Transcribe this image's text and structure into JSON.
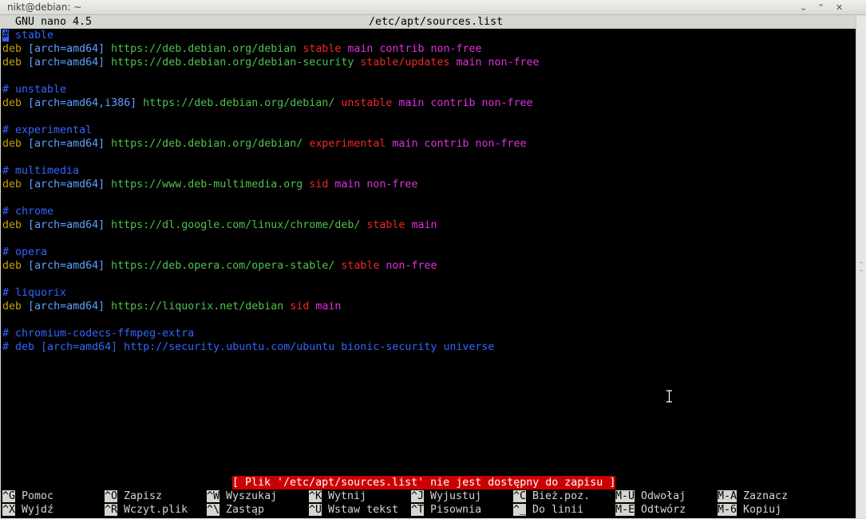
{
  "window": {
    "title": "nikt@debian: ~",
    "minimize": "⌃",
    "maximize": "⌃",
    "close": "✕"
  },
  "nano": {
    "version": "GNU nano 4.5",
    "filename": "/etc/apt/sources.list"
  },
  "file_lines": [
    {
      "type": "comment",
      "text": "# stable"
    },
    {
      "type": "deb",
      "deb": "deb",
      "arch": "[arch=amd64]",
      "url": "https://deb.debian.org/debian",
      "dist": "stable",
      "components": "main contrib non-free"
    },
    {
      "type": "deb",
      "deb": "deb",
      "arch": "[arch=amd64]",
      "url": "https://deb.debian.org/debian-security",
      "dist": "stable/updates",
      "components": "main non-free"
    },
    {
      "type": "blank"
    },
    {
      "type": "comment",
      "text": "# unstable"
    },
    {
      "type": "deb",
      "deb": "deb",
      "arch": "[arch=amd64,i386]",
      "url": "https://deb.debian.org/debian/",
      "dist": "unstable",
      "components": "main contrib non-free"
    },
    {
      "type": "blank"
    },
    {
      "type": "comment",
      "text": "# experimental"
    },
    {
      "type": "deb",
      "deb": "deb",
      "arch": "[arch=amd64]",
      "url": "https://deb.debian.org/debian/",
      "dist": "experimental",
      "components": "main contrib non-free"
    },
    {
      "type": "blank"
    },
    {
      "type": "comment",
      "text": "# multimedia"
    },
    {
      "type": "deb",
      "deb": "deb",
      "arch": "[arch=amd64]",
      "url": "https://www.deb-multimedia.org",
      "dist": "sid",
      "components": "main non-free"
    },
    {
      "type": "blank"
    },
    {
      "type": "comment",
      "text": "# chrome"
    },
    {
      "type": "deb",
      "deb": "deb",
      "arch": "[arch=amd64]",
      "url": "https://dl.google.com/linux/chrome/deb/",
      "dist": "stable",
      "components": "main"
    },
    {
      "type": "blank"
    },
    {
      "type": "comment",
      "text": "# opera"
    },
    {
      "type": "deb",
      "deb": "deb",
      "arch": "[arch=amd64]",
      "url": "https://deb.opera.com/opera-stable/",
      "dist": "stable",
      "components": "non-free"
    },
    {
      "type": "blank"
    },
    {
      "type": "comment",
      "text": "# liquorix"
    },
    {
      "type": "deb",
      "deb": "deb",
      "arch": "[arch=amd64]",
      "url": "https://liquorix.net/debian",
      "dist": "sid",
      "components": "main"
    },
    {
      "type": "blank"
    },
    {
      "type": "comment",
      "text": "# chromium-codecs-ffmpeg-extra"
    },
    {
      "type": "comment",
      "text": "# deb [arch=amd64] http://security.ubuntu.com/ubuntu bionic-security universe"
    }
  ],
  "status_message": "[ Plik '/etc/apt/sources.list' nie jest dostępny do zapisu ]",
  "shortcuts_row1": [
    {
      "key": "^G",
      "label": "Pomoc"
    },
    {
      "key": "^O",
      "label": "Zapisz"
    },
    {
      "key": "^W",
      "label": "Wyszukaj"
    },
    {
      "key": "^K",
      "label": "Wytnij"
    },
    {
      "key": "^J",
      "label": "Wyjustuj"
    },
    {
      "key": "^C",
      "label": "Bież.poz."
    },
    {
      "key": "M-U",
      "label": "Odwołaj"
    },
    {
      "key": "M-A",
      "label": "Zaznacz"
    }
  ],
  "shortcuts_row2": [
    {
      "key": "^X",
      "label": "Wyjdź"
    },
    {
      "key": "^R",
      "label": "Wczyt.plik"
    },
    {
      "key": "^\\",
      "label": "Zastąp"
    },
    {
      "key": "^U",
      "label": "Wstaw tekst"
    },
    {
      "key": "^T",
      "label": "Pisownia"
    },
    {
      "key": "^_",
      "label": "Do linii"
    },
    {
      "key": "M-E",
      "label": "Odtwórz"
    },
    {
      "key": "M-6",
      "label": "Kopiuj"
    }
  ],
  "colors": {
    "comment": "#3465ff",
    "deb": "#c4a000",
    "arch": "#5ea0ff",
    "url": "#4ec24e",
    "dist": "#ef2929",
    "components": "#e030e0",
    "status_bg": "#cc0000"
  },
  "icons": {
    "cursor": "i-beam-cursor-icon"
  }
}
